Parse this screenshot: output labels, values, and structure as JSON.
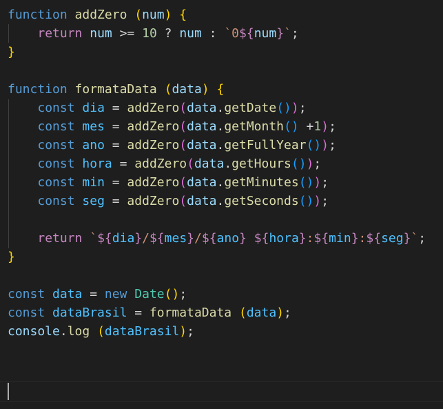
{
  "code": {
    "lines": [
      [
        {
          "t": "function",
          "c": "kw"
        },
        {
          "t": " "
        },
        {
          "t": "addZero",
          "c": "fn"
        },
        {
          "t": " "
        },
        {
          "t": "(",
          "c": "b1"
        },
        {
          "t": "num",
          "c": "var"
        },
        {
          "t": ")",
          "c": "b1"
        },
        {
          "t": " "
        },
        {
          "t": "{",
          "c": "b1"
        }
      ],
      [
        {
          "t": "    "
        },
        {
          "t": "return",
          "c": "ctl"
        },
        {
          "t": " "
        },
        {
          "t": "num",
          "c": "var"
        },
        {
          "t": " >= ",
          "c": "op"
        },
        {
          "t": "10",
          "c": "num"
        },
        {
          "t": " ? ",
          "c": "op"
        },
        {
          "t": "num",
          "c": "var"
        },
        {
          "t": " : ",
          "c": "op"
        },
        {
          "t": "`0",
          "c": "str"
        },
        {
          "t": "${",
          "c": "ctl"
        },
        {
          "t": "num",
          "c": "var"
        },
        {
          "t": "}",
          "c": "ctl"
        },
        {
          "t": "`",
          "c": "str"
        },
        {
          "t": ";",
          "c": "op"
        }
      ],
      [
        {
          "t": "}",
          "c": "b1"
        }
      ],
      [],
      [
        {
          "t": "function",
          "c": "kw"
        },
        {
          "t": " "
        },
        {
          "t": "formataData",
          "c": "fn"
        },
        {
          "t": " "
        },
        {
          "t": "(",
          "c": "b1"
        },
        {
          "t": "data",
          "c": "var"
        },
        {
          "t": ")",
          "c": "b1"
        },
        {
          "t": " "
        },
        {
          "t": "{",
          "c": "b1"
        }
      ],
      [
        {
          "t": "    "
        },
        {
          "t": "const",
          "c": "kw"
        },
        {
          "t": " "
        },
        {
          "t": "dia",
          "c": "cst"
        },
        {
          "t": " = ",
          "c": "op"
        },
        {
          "t": "addZero",
          "c": "fn"
        },
        {
          "t": "(",
          "c": "b2"
        },
        {
          "t": "data",
          "c": "var"
        },
        {
          "t": ".",
          "c": "op"
        },
        {
          "t": "getDate",
          "c": "fn"
        },
        {
          "t": "()",
          "c": "b3"
        },
        {
          "t": ")",
          "c": "b2"
        },
        {
          "t": ";",
          "c": "op"
        }
      ],
      [
        {
          "t": "    "
        },
        {
          "t": "const",
          "c": "kw"
        },
        {
          "t": " "
        },
        {
          "t": "mes",
          "c": "cst"
        },
        {
          "t": " = ",
          "c": "op"
        },
        {
          "t": "addZero",
          "c": "fn"
        },
        {
          "t": "(",
          "c": "b2"
        },
        {
          "t": "data",
          "c": "var"
        },
        {
          "t": ".",
          "c": "op"
        },
        {
          "t": "getMonth",
          "c": "fn"
        },
        {
          "t": "()",
          "c": "b3"
        },
        {
          "t": " +",
          "c": "op"
        },
        {
          "t": "1",
          "c": "num"
        },
        {
          "t": ")",
          "c": "b2"
        },
        {
          "t": ";",
          "c": "op"
        }
      ],
      [
        {
          "t": "    "
        },
        {
          "t": "const",
          "c": "kw"
        },
        {
          "t": " "
        },
        {
          "t": "ano",
          "c": "cst"
        },
        {
          "t": " = ",
          "c": "op"
        },
        {
          "t": "addZero",
          "c": "fn"
        },
        {
          "t": "(",
          "c": "b2"
        },
        {
          "t": "data",
          "c": "var"
        },
        {
          "t": ".",
          "c": "op"
        },
        {
          "t": "getFullYear",
          "c": "fn"
        },
        {
          "t": "()",
          "c": "b3"
        },
        {
          "t": ")",
          "c": "b2"
        },
        {
          "t": ";",
          "c": "op"
        }
      ],
      [
        {
          "t": "    "
        },
        {
          "t": "const",
          "c": "kw"
        },
        {
          "t": " "
        },
        {
          "t": "hora",
          "c": "cst"
        },
        {
          "t": " = ",
          "c": "op"
        },
        {
          "t": "addZero",
          "c": "fn"
        },
        {
          "t": "(",
          "c": "b2"
        },
        {
          "t": "data",
          "c": "var"
        },
        {
          "t": ".",
          "c": "op"
        },
        {
          "t": "getHours",
          "c": "fn"
        },
        {
          "t": "()",
          "c": "b3"
        },
        {
          "t": ")",
          "c": "b2"
        },
        {
          "t": ";",
          "c": "op"
        }
      ],
      [
        {
          "t": "    "
        },
        {
          "t": "const",
          "c": "kw"
        },
        {
          "t": " "
        },
        {
          "t": "min",
          "c": "cst"
        },
        {
          "t": " = ",
          "c": "op"
        },
        {
          "t": "addZero",
          "c": "fn"
        },
        {
          "t": "(",
          "c": "b2"
        },
        {
          "t": "data",
          "c": "var"
        },
        {
          "t": ".",
          "c": "op"
        },
        {
          "t": "getMinutes",
          "c": "fn"
        },
        {
          "t": "()",
          "c": "b3"
        },
        {
          "t": ")",
          "c": "b2"
        },
        {
          "t": ";",
          "c": "op"
        }
      ],
      [
        {
          "t": "    "
        },
        {
          "t": "const",
          "c": "kw"
        },
        {
          "t": " "
        },
        {
          "t": "seg",
          "c": "cst"
        },
        {
          "t": " = ",
          "c": "op"
        },
        {
          "t": "addZero",
          "c": "fn"
        },
        {
          "t": "(",
          "c": "b2"
        },
        {
          "t": "data",
          "c": "var"
        },
        {
          "t": ".",
          "c": "op"
        },
        {
          "t": "getSeconds",
          "c": "fn"
        },
        {
          "t": "()",
          "c": "b3"
        },
        {
          "t": ")",
          "c": "b2"
        },
        {
          "t": ";",
          "c": "op"
        }
      ],
      [],
      [
        {
          "t": "    "
        },
        {
          "t": "return",
          "c": "ctl"
        },
        {
          "t": " "
        },
        {
          "t": "`",
          "c": "str"
        },
        {
          "t": "${",
          "c": "ctl"
        },
        {
          "t": "dia",
          "c": "cst"
        },
        {
          "t": "}",
          "c": "ctl"
        },
        {
          "t": "/",
          "c": "str"
        },
        {
          "t": "${",
          "c": "ctl"
        },
        {
          "t": "mes",
          "c": "cst"
        },
        {
          "t": "}",
          "c": "ctl"
        },
        {
          "t": "/",
          "c": "str"
        },
        {
          "t": "${",
          "c": "ctl"
        },
        {
          "t": "ano",
          "c": "cst"
        },
        {
          "t": "}",
          "c": "ctl"
        },
        {
          "t": " ",
          "c": "str"
        },
        {
          "t": "${",
          "c": "ctl"
        },
        {
          "t": "hora",
          "c": "cst"
        },
        {
          "t": "}",
          "c": "ctl"
        },
        {
          "t": ":",
          "c": "str"
        },
        {
          "t": "${",
          "c": "ctl"
        },
        {
          "t": "min",
          "c": "cst"
        },
        {
          "t": "}",
          "c": "ctl"
        },
        {
          "t": ":",
          "c": "str"
        },
        {
          "t": "${",
          "c": "ctl"
        },
        {
          "t": "seg",
          "c": "cst"
        },
        {
          "t": "}",
          "c": "ctl"
        },
        {
          "t": "`",
          "c": "str"
        },
        {
          "t": ";",
          "c": "op"
        }
      ],
      [
        {
          "t": "}",
          "c": "b1"
        }
      ],
      [],
      [
        {
          "t": "const",
          "c": "kw"
        },
        {
          "t": " "
        },
        {
          "t": "data",
          "c": "cst"
        },
        {
          "t": " = ",
          "c": "op"
        },
        {
          "t": "new",
          "c": "kw"
        },
        {
          "t": " "
        },
        {
          "t": "Date",
          "c": "cls"
        },
        {
          "t": "()",
          "c": "b1"
        },
        {
          "t": ";",
          "c": "op"
        }
      ],
      [
        {
          "t": "const",
          "c": "kw"
        },
        {
          "t": " "
        },
        {
          "t": "dataBrasil",
          "c": "cst"
        },
        {
          "t": " = ",
          "c": "op"
        },
        {
          "t": "formataData",
          "c": "fn"
        },
        {
          "t": " "
        },
        {
          "t": "(",
          "c": "b1"
        },
        {
          "t": "data",
          "c": "cst"
        },
        {
          "t": ")",
          "c": "b1"
        },
        {
          "t": ";",
          "c": "op"
        }
      ],
      [
        {
          "t": "console",
          "c": "var"
        },
        {
          "t": ".",
          "c": "op"
        },
        {
          "t": "log",
          "c": "fn"
        },
        {
          "t": " "
        },
        {
          "t": "(",
          "c": "b1"
        },
        {
          "t": "dataBrasil",
          "c": "cst"
        },
        {
          "t": ")",
          "c": "b1"
        },
        {
          "t": ";",
          "c": "op"
        }
      ]
    ]
  }
}
